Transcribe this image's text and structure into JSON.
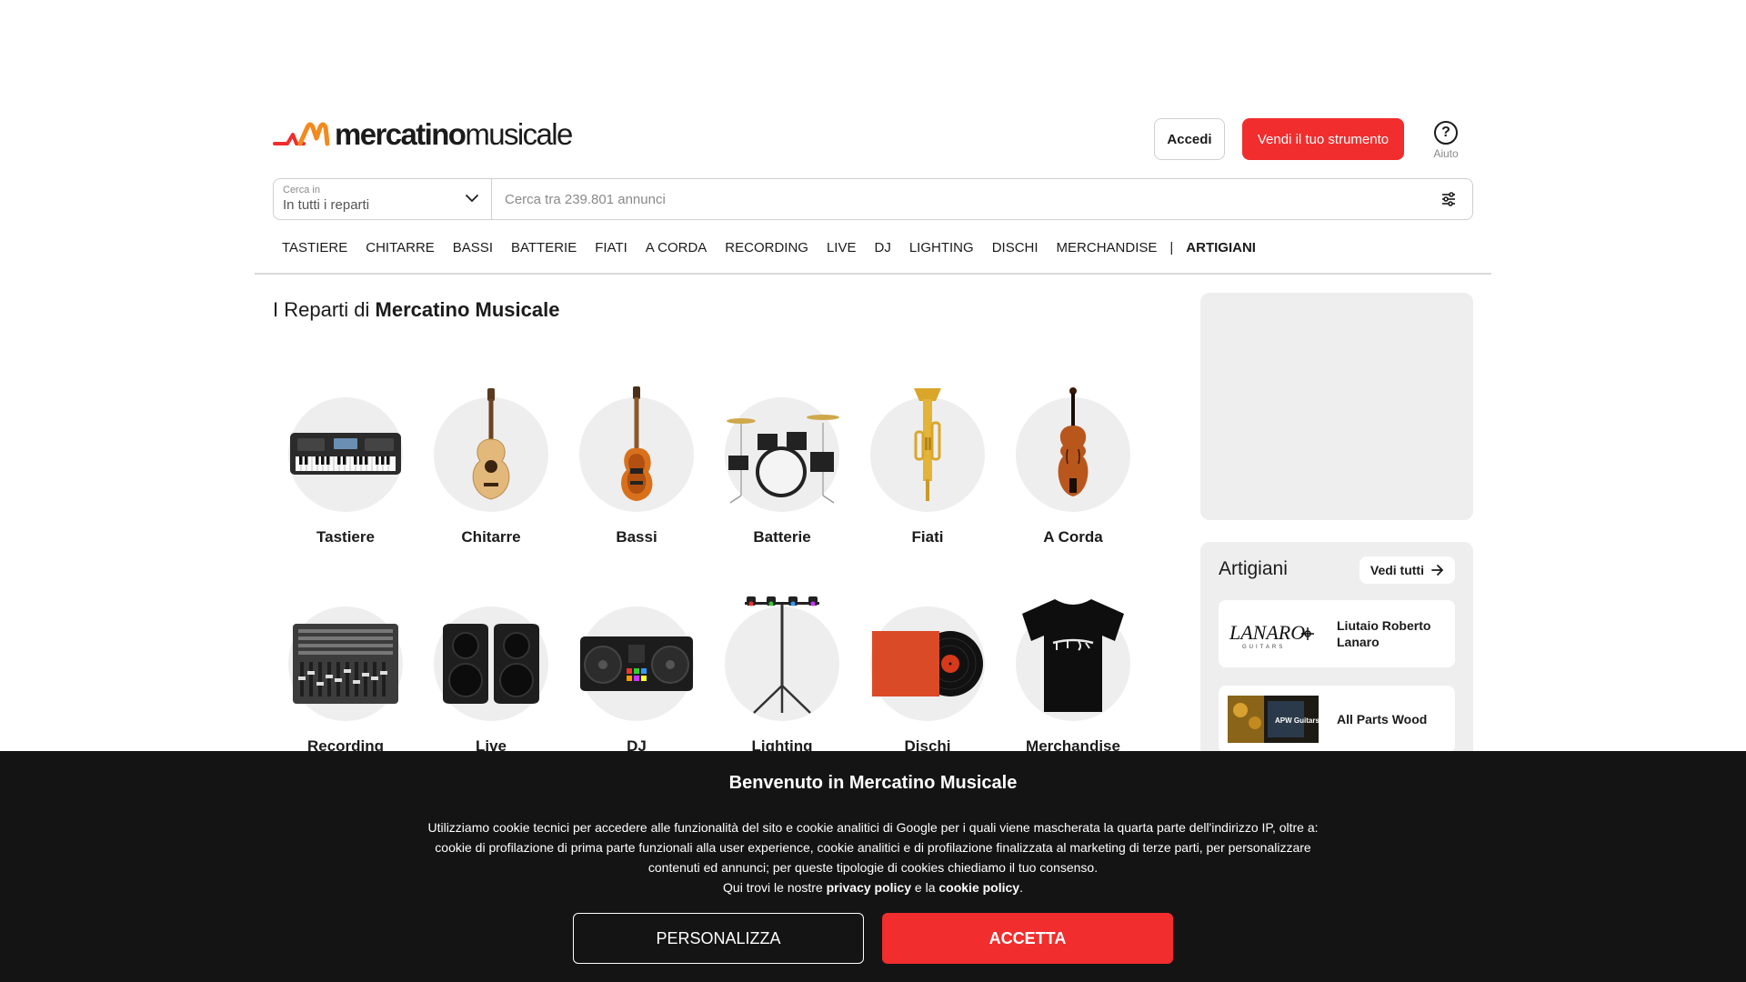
{
  "brand": {
    "logo_bold": "mercatino",
    "logo_light": "musicale",
    "accent": "#f12d2d"
  },
  "header": {
    "login_label": "Accedi",
    "sell_label": "Vendi il tuo strumento",
    "help_icon": "question-icon",
    "help_label": "Aiuto"
  },
  "search": {
    "dept_label": "Cerca in",
    "dept_value": "In tutti i reparti",
    "placeholder": "Cerca tra 239.801 annunci",
    "filter_icon": "sliders-icon"
  },
  "nav": {
    "items": [
      "TASTIERE",
      "CHITARRE",
      "BASSI",
      "BATTERIE",
      "FIATI",
      "A CORDA",
      "RECORDING",
      "LIVE",
      "DJ",
      "LIGHTING",
      "DISCHI",
      "MERCHANDISE"
    ],
    "separator": "|",
    "highlight": "ARTIGIANI"
  },
  "section": {
    "title_prefix": "I Reparti di",
    "title_bold": "Mercatino Musicale"
  },
  "categories": [
    {
      "label": "Tastiere",
      "icon": "keyboard-icon"
    },
    {
      "label": "Chitarre",
      "icon": "guitar-icon"
    },
    {
      "label": "Bassi",
      "icon": "bass-icon"
    },
    {
      "label": "Batterie",
      "icon": "drums-icon"
    },
    {
      "label": "Fiati",
      "icon": "trumpet-icon"
    },
    {
      "label": "A Corda",
      "icon": "violin-icon"
    },
    {
      "label": "Recording",
      "icon": "mixer-icon"
    },
    {
      "label": "Live",
      "icon": "speaker-icon"
    },
    {
      "label": "DJ",
      "icon": "dj-controller-icon"
    },
    {
      "label": "Lighting",
      "icon": "lighting-stand-icon"
    },
    {
      "label": "Dischi",
      "icon": "vinyl-icon"
    },
    {
      "label": "Merchandise",
      "icon": "tshirt-icon"
    }
  ],
  "artisans": {
    "title": "Artigiani",
    "see_all": "Vedi tutti",
    "items": [
      {
        "name": "Liutaio Roberto Lanaro",
        "logo_text": "LANARO",
        "logo_sub": "GUITARS"
      },
      {
        "name": "All Parts Wood",
        "logo_text": "APW Guitars"
      }
    ]
  },
  "cookie": {
    "title": "Benvenuto in Mercatino Musicale",
    "body": "Utilizziamo cookie tecnici per accedere alle funzionalità del sito e cookie analitici di Google per i quali viene mascherata la quarta parte dell'indirizzo IP, oltre a: cookie di profilazione di prima parte funzionali alla user experience, cookie analitici e di profilazione finalizzata al marketing di terze parti, per personalizzare contenuti ed annunci; per queste tipologie di cookies chiediamo il tuo consenso.",
    "links_prefix": "Qui trovi le nostre",
    "privacy_link": "privacy policy",
    "links_and": "e la",
    "cookie_link": "cookie policy",
    "links_suffix": ".",
    "customize_label": "PERSONALIZZA",
    "accept_label": "ACCETTA"
  }
}
